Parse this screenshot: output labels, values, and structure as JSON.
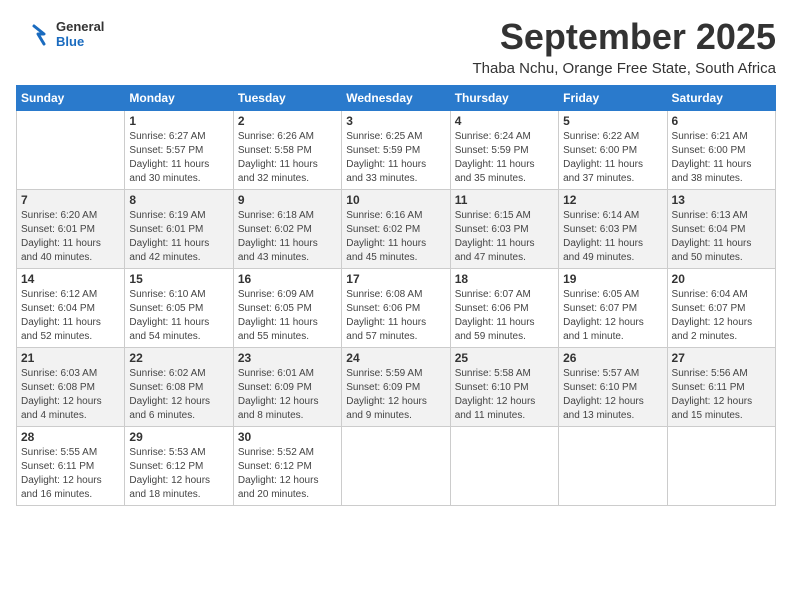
{
  "logo": {
    "line1": "General",
    "line2": "Blue"
  },
  "title": "September 2025",
  "subtitle": "Thaba Nchu, Orange Free State, South Africa",
  "days_of_week": [
    "Sunday",
    "Monday",
    "Tuesday",
    "Wednesday",
    "Thursday",
    "Friday",
    "Saturday"
  ],
  "weeks": [
    [
      {
        "day": "",
        "info": ""
      },
      {
        "day": "1",
        "info": "Sunrise: 6:27 AM\nSunset: 5:57 PM\nDaylight: 11 hours\nand 30 minutes."
      },
      {
        "day": "2",
        "info": "Sunrise: 6:26 AM\nSunset: 5:58 PM\nDaylight: 11 hours\nand 32 minutes."
      },
      {
        "day": "3",
        "info": "Sunrise: 6:25 AM\nSunset: 5:59 PM\nDaylight: 11 hours\nand 33 minutes."
      },
      {
        "day": "4",
        "info": "Sunrise: 6:24 AM\nSunset: 5:59 PM\nDaylight: 11 hours\nand 35 minutes."
      },
      {
        "day": "5",
        "info": "Sunrise: 6:22 AM\nSunset: 6:00 PM\nDaylight: 11 hours\nand 37 minutes."
      },
      {
        "day": "6",
        "info": "Sunrise: 6:21 AM\nSunset: 6:00 PM\nDaylight: 11 hours\nand 38 minutes."
      }
    ],
    [
      {
        "day": "7",
        "info": "Sunrise: 6:20 AM\nSunset: 6:01 PM\nDaylight: 11 hours\nand 40 minutes."
      },
      {
        "day": "8",
        "info": "Sunrise: 6:19 AM\nSunset: 6:01 PM\nDaylight: 11 hours\nand 42 minutes."
      },
      {
        "day": "9",
        "info": "Sunrise: 6:18 AM\nSunset: 6:02 PM\nDaylight: 11 hours\nand 43 minutes."
      },
      {
        "day": "10",
        "info": "Sunrise: 6:16 AM\nSunset: 6:02 PM\nDaylight: 11 hours\nand 45 minutes."
      },
      {
        "day": "11",
        "info": "Sunrise: 6:15 AM\nSunset: 6:03 PM\nDaylight: 11 hours\nand 47 minutes."
      },
      {
        "day": "12",
        "info": "Sunrise: 6:14 AM\nSunset: 6:03 PM\nDaylight: 11 hours\nand 49 minutes."
      },
      {
        "day": "13",
        "info": "Sunrise: 6:13 AM\nSunset: 6:04 PM\nDaylight: 11 hours\nand 50 minutes."
      }
    ],
    [
      {
        "day": "14",
        "info": "Sunrise: 6:12 AM\nSunset: 6:04 PM\nDaylight: 11 hours\nand 52 minutes."
      },
      {
        "day": "15",
        "info": "Sunrise: 6:10 AM\nSunset: 6:05 PM\nDaylight: 11 hours\nand 54 minutes."
      },
      {
        "day": "16",
        "info": "Sunrise: 6:09 AM\nSunset: 6:05 PM\nDaylight: 11 hours\nand 55 minutes."
      },
      {
        "day": "17",
        "info": "Sunrise: 6:08 AM\nSunset: 6:06 PM\nDaylight: 11 hours\nand 57 minutes."
      },
      {
        "day": "18",
        "info": "Sunrise: 6:07 AM\nSunset: 6:06 PM\nDaylight: 11 hours\nand 59 minutes."
      },
      {
        "day": "19",
        "info": "Sunrise: 6:05 AM\nSunset: 6:07 PM\nDaylight: 12 hours\nand 1 minute."
      },
      {
        "day": "20",
        "info": "Sunrise: 6:04 AM\nSunset: 6:07 PM\nDaylight: 12 hours\nand 2 minutes."
      }
    ],
    [
      {
        "day": "21",
        "info": "Sunrise: 6:03 AM\nSunset: 6:08 PM\nDaylight: 12 hours\nand 4 minutes."
      },
      {
        "day": "22",
        "info": "Sunrise: 6:02 AM\nSunset: 6:08 PM\nDaylight: 12 hours\nand 6 minutes."
      },
      {
        "day": "23",
        "info": "Sunrise: 6:01 AM\nSunset: 6:09 PM\nDaylight: 12 hours\nand 8 minutes."
      },
      {
        "day": "24",
        "info": "Sunrise: 5:59 AM\nSunset: 6:09 PM\nDaylight: 12 hours\nand 9 minutes."
      },
      {
        "day": "25",
        "info": "Sunrise: 5:58 AM\nSunset: 6:10 PM\nDaylight: 12 hours\nand 11 minutes."
      },
      {
        "day": "26",
        "info": "Sunrise: 5:57 AM\nSunset: 6:10 PM\nDaylight: 12 hours\nand 13 minutes."
      },
      {
        "day": "27",
        "info": "Sunrise: 5:56 AM\nSunset: 6:11 PM\nDaylight: 12 hours\nand 15 minutes."
      }
    ],
    [
      {
        "day": "28",
        "info": "Sunrise: 5:55 AM\nSunset: 6:11 PM\nDaylight: 12 hours\nand 16 minutes."
      },
      {
        "day": "29",
        "info": "Sunrise: 5:53 AM\nSunset: 6:12 PM\nDaylight: 12 hours\nand 18 minutes."
      },
      {
        "day": "30",
        "info": "Sunrise: 5:52 AM\nSunset: 6:12 PM\nDaylight: 12 hours\nand 20 minutes."
      },
      {
        "day": "",
        "info": ""
      },
      {
        "day": "",
        "info": ""
      },
      {
        "day": "",
        "info": ""
      },
      {
        "day": "",
        "info": ""
      }
    ]
  ]
}
